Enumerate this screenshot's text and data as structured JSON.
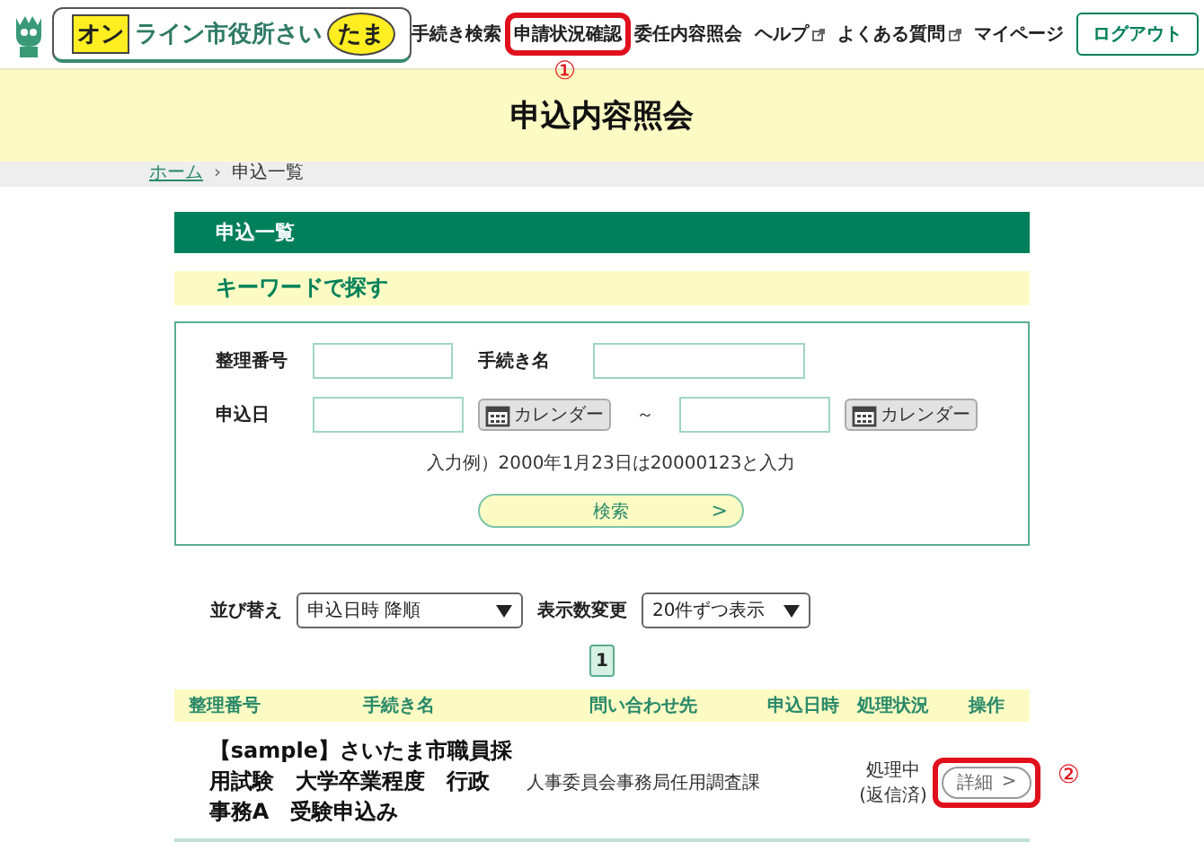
{
  "logo": {
    "highlight_1": "オン",
    "text": "ライン市役所さい",
    "highlight_2": "たま"
  },
  "nav": [
    {
      "label": "手続き検索",
      "external": false
    },
    {
      "label": "申請状況確認",
      "external": false,
      "annotation": "①"
    },
    {
      "label": "委任内容照会",
      "external": false
    },
    {
      "label": "ヘルプ",
      "external": true
    },
    {
      "label": "よくある質問",
      "external": true
    },
    {
      "label": "マイページ",
      "external": false
    }
  ],
  "logout": "ログアウト",
  "page_title": "申込内容照会",
  "breadcrumb": [
    {
      "label": "ホーム",
      "link": true
    },
    {
      "label": "申込一覧",
      "link": false
    }
  ],
  "breadcrumb_separator": "›",
  "section_title": "申込一覧",
  "search_title": "キーワードで探す",
  "search": {
    "number_label": "整理番号",
    "name_label": "手続き名",
    "date_label": "申込日",
    "calendar_buttons": [
      "カレンダー",
      "カレンダー"
    ],
    "range": "～",
    "hint": "入力例）2000年1月23日は20000123と入力",
    "button": "検索",
    "button_arrow": ">"
  },
  "sort": {
    "sort_label": "並び替え",
    "sort_value": "申込日時 降順",
    "count_label": "表示数変更",
    "count_value": "20件ずつ表示"
  },
  "pages": [
    {
      "label": "1",
      "selected": true
    }
  ],
  "columns": [
    "整理番号",
    "手続き名",
    "問い合わせ先",
    "申込日時",
    "処理状況",
    "操作"
  ],
  "rows": [
    {
      "name_lines": [
        "【sample】さいたま市職員採",
        "用試験　大学卒業程度　行政",
        "事務A　受験申込み"
      ],
      "contact": "人事委員会事務局任用調査課",
      "status": "処理中\n(返信済)",
      "action": "詳細",
      "action_arrow": ">",
      "annotation": "②"
    }
  ]
}
